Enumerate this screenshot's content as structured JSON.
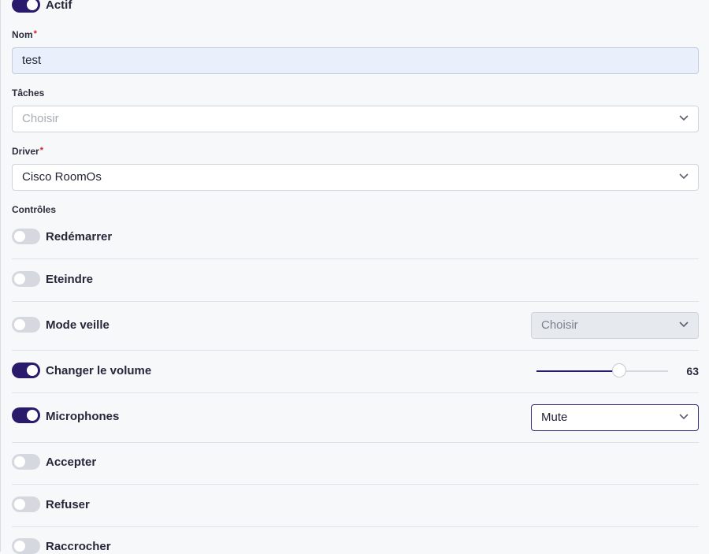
{
  "active": {
    "label": "Actif",
    "checked": true
  },
  "name_field": {
    "label": "Nom",
    "required_mark": "*",
    "value": "test"
  },
  "tasks_field": {
    "label": "Tâches",
    "placeholder": "Choisir"
  },
  "driver_field": {
    "label": "Driver",
    "required_mark": "*",
    "value": "Cisco RoomOs"
  },
  "controls": {
    "title": "Contrôles",
    "items": [
      {
        "label": "Redémarrer",
        "checked": false
      },
      {
        "label": "Eteindre",
        "checked": false
      },
      {
        "label": "Mode veille",
        "checked": false,
        "select_placeholder": "Choisir"
      },
      {
        "label": "Changer le volume",
        "checked": true,
        "volume": 63
      },
      {
        "label": "Microphones",
        "checked": true,
        "select_value": "Mute"
      },
      {
        "label": "Accepter",
        "checked": false
      },
      {
        "label": "Refuser",
        "checked": false
      },
      {
        "label": "Raccrocher",
        "checked": false
      }
    ]
  },
  "colors": {
    "accent": "#2a1a6b",
    "required": "#d11f2a"
  }
}
